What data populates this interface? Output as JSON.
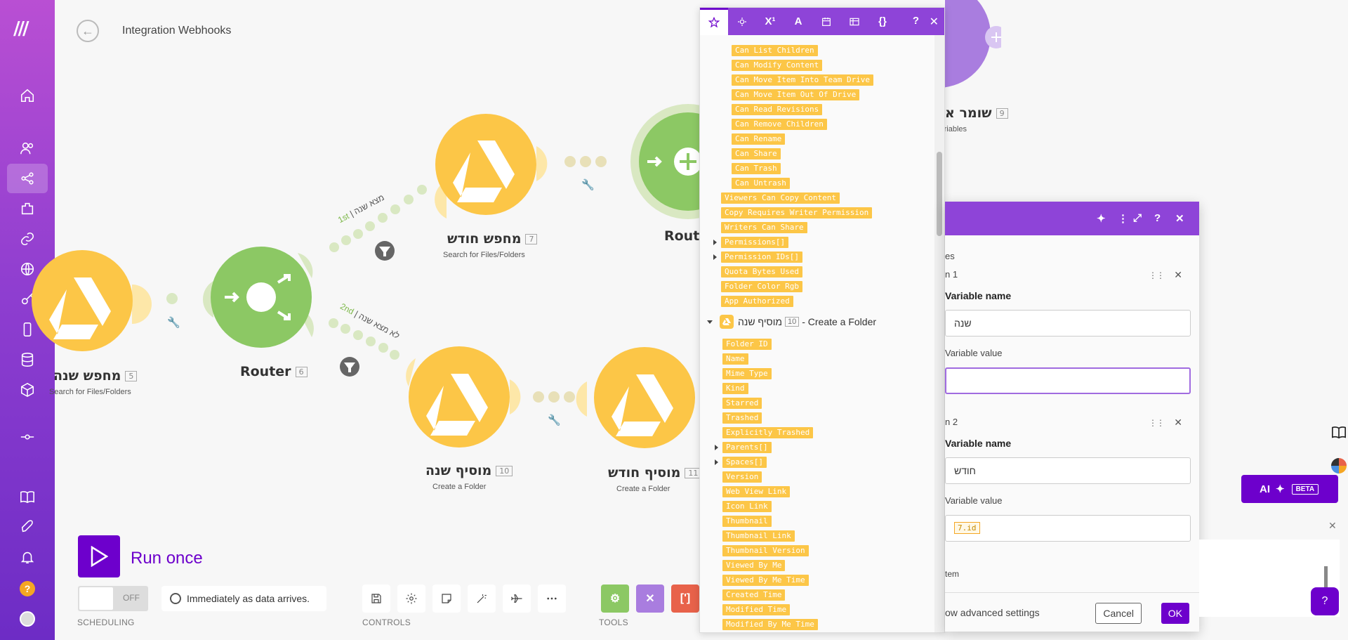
{
  "header": {
    "title": "Integration Webhooks"
  },
  "sidebar": {
    "items": [
      "home",
      "team",
      "scenarios",
      "templates",
      "connections",
      "webhooks",
      "keys",
      "devices",
      "datastores",
      "datastructures",
      "flow-control",
      "docs",
      "whats-new",
      "notifications",
      "help",
      "profile"
    ],
    "help_label": "?"
  },
  "modules": {
    "m5": {
      "title": "מחפש שנה",
      "num": "5",
      "subtitle": "Search for Files/Folders"
    },
    "m6": {
      "title": "Router",
      "num": "6"
    },
    "m7": {
      "title": "מחפש חודש",
      "num": "7",
      "subtitle": "Search for Files/Folders"
    },
    "m8": {
      "title": "Router"
    },
    "m9": {
      "title": "שומר א",
      "num": "9",
      "subtitle": "Variables"
    },
    "m10": {
      "title": "מוסיף שנה",
      "num": "10",
      "subtitle": "Create a Folder"
    },
    "m11": {
      "title": "מוסיף חודש",
      "num": "11",
      "subtitle": "Create a Folder"
    }
  },
  "routes": {
    "first": "1st",
    "first_label": "מצא שנה",
    "second": "2nd",
    "second_label": "לא מצא שנה"
  },
  "toolbar": {
    "run_label": "Run once",
    "toggle_label": "OFF",
    "schedule_text": "Immediately as data arrives.",
    "group_scheduling": "SCHEDULING",
    "group_controls": "CONTROLS",
    "group_tools": "TOOLS"
  },
  "mapping_panel": {
    "tabs": [
      "favorites",
      "general",
      "math",
      "text",
      "date",
      "array",
      "json"
    ],
    "help": "?",
    "close": "✕",
    "items_top": [
      "Can List Children",
      "Can Modify Content",
      "Can Move Item Into Team Drive",
      "Can Move Item Out Of Drive",
      "Can Read Revisions",
      "Can Remove Children",
      "Can Rename",
      "Can Share",
      "Can Trash",
      "Can Untrash"
    ],
    "items_mid": [
      "Viewers Can Copy Content",
      "Copy Requires Writer Permission",
      "Writers Can Share",
      "Permissions[]",
      "Permission IDs[]",
      "Quota Bytes Used",
      "Folder Color Rgb",
      "App Authorized"
    ],
    "group": {
      "name": "מוסיף שנה",
      "num": "10",
      "action": "- Create a Folder"
    },
    "items_group": [
      "Folder ID",
      "Name",
      "Mime Type",
      "Kind",
      "Starred",
      "Trashed",
      "Explicitly Trashed",
      "Parents[]",
      "Spaces[]",
      "Version",
      "Web View Link",
      "Icon Link",
      "Thumbnail",
      "Thumbnail Link",
      "Thumbnail Version",
      "Viewed By Me",
      "Viewed By Me Time",
      "Created Time",
      "Modified Time",
      "Modified By Me Time"
    ]
  },
  "dialog": {
    "section": "es",
    "item1_label": "n 1",
    "item2_label": "n 2",
    "var_name_label": "Variable name",
    "var_value_label": "Variable value",
    "var1_name": "שנה",
    "var1_value": "",
    "var2_name": "חודש",
    "var2_value": "7.id",
    "add_item": "tem",
    "advanced": "ow advanced settings",
    "cancel": "Cancel",
    "ok": "OK"
  },
  "ai": {
    "label": "AI",
    "beta": "BETA"
  },
  "colors": {
    "accent": "#6d00cc",
    "drive": "#fcc647",
    "router": "#8cc864",
    "panel": "#8e44d8"
  }
}
